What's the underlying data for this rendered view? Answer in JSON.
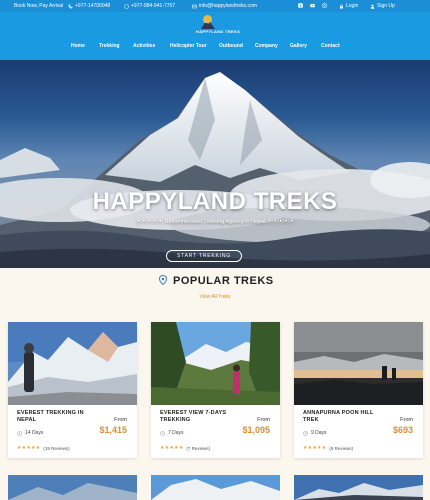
{
  "topbar": {
    "promo": "Book Now, Pay Arrival",
    "phone1": "+977-14700048",
    "phone2": "+977-984-941-7757",
    "email": "info@happylandtreks.com",
    "login": "Login",
    "signup": "Sign Up"
  },
  "logo": {
    "brand": "HAPPYLAND TREKS"
  },
  "nav": {
    "items": [
      "Home",
      "Trekking",
      "Activities",
      "Helicopter Tour",
      "Outbound",
      "Company",
      "Gallery",
      "Contact"
    ],
    "active": "Home"
  },
  "hero": {
    "title": "HAPPYLAND TREKS",
    "subtitle": "⦿⦿⦿⦿⦿ Recommended Trekking Agency in Nepal ⦿⦿⦿⦿⦿",
    "button": "START TREKKING"
  },
  "section": {
    "title": "POPULAR TREKS",
    "link": "View All Treks"
  },
  "treks": [
    {
      "title": "EVEREST TREKKING IN NEPAL",
      "from": "From",
      "price": "$1,415",
      "days": "14 Days",
      "stars": "★★★★★",
      "reviews": "(15 Reviews)"
    },
    {
      "title": "EVEREST VIEW 7-DAYS TREKKING",
      "from": "From",
      "price": "$1,095",
      "days": "7 Days",
      "stars": "★★★★★",
      "reviews": "(7 Reviews)"
    },
    {
      "title": "ANNAPURNA POON HILL TREK",
      "from": "From",
      "price": "$693",
      "days": "9 Days",
      "stars": "★★★★★",
      "reviews": "(8 Reviews)"
    }
  ],
  "colors": {
    "topbar": "#1a8fd8",
    "header": "#1a9ae0",
    "accent": "#e08a1e",
    "price": "#d9902f"
  }
}
